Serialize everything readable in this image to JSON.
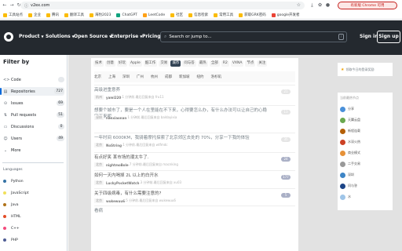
{
  "browser": {
    "url": "v2ex.com",
    "update_label": "有新版 Chrome 可用",
    "bookmarks": [
      {
        "label": "工具站点",
        "color": "#fbbc04"
      },
      {
        "label": "企业",
        "color": "#fbbc04"
      },
      {
        "label": "腾讯",
        "color": "#fbbc04"
      },
      {
        "label": "翻译工具",
        "color": "#fbbc04"
      },
      {
        "label": "海豹2023",
        "color": "#fbbc04"
      },
      {
        "label": "ChatGPT",
        "color": "#10a37f"
      },
      {
        "label": "LeetCode",
        "color": "#ffa116"
      },
      {
        "label": "社区",
        "color": "#fbbc04"
      },
      {
        "label": "信息检索",
        "color": "#fbbc04"
      },
      {
        "label": "常用工具",
        "color": "#fbbc04"
      },
      {
        "label": "获取GRK密码",
        "color": "#fbbc04"
      },
      {
        "label": "google开发者",
        "color": "#ea4335"
      }
    ]
  },
  "github": {
    "nav": [
      "Product",
      "Solutions",
      "Open Source",
      "Enterprise",
      "Pricing"
    ],
    "search_placeholder": "Search or jump to...",
    "search_key": "/",
    "signin": "Sign in",
    "signup": "Sign up"
  },
  "filter": {
    "title": "Filter by",
    "items": [
      {
        "label": "Code",
        "count": "",
        "icon": "code-icon"
      },
      {
        "label": "Repositories",
        "count": "727",
        "icon": "repo-icon"
      },
      {
        "label": "Issues",
        "count": "69",
        "icon": "issue-icon"
      },
      {
        "label": "Pull requests",
        "count": "51",
        "icon": "pull-request-icon"
      },
      {
        "label": "Discussions",
        "count": "0",
        "icon": "discussion-icon"
      },
      {
        "label": "Users",
        "count": "49",
        "icon": "user-icon"
      },
      {
        "label": "More",
        "count": "",
        "icon": "chevron-down-icon"
      }
    ],
    "languages_title": "Languages",
    "languages": [
      {
        "label": "Python",
        "color": "#3572A5"
      },
      {
        "label": "JavaScript",
        "color": "#f1e05a"
      },
      {
        "label": "Java",
        "color": "#b07219"
      },
      {
        "label": "HTML",
        "color": "#e34c26"
      },
      {
        "label": "C++",
        "color": "#f34b7d"
      },
      {
        "label": "PHP",
        "color": "#4F5D95"
      }
    ]
  },
  "v2ex": {
    "tabs": [
      "技术",
      "创意",
      "好玩",
      "Apple",
      "酷工作",
      "交易",
      "城市",
      "问与答",
      "最热",
      "全部",
      "R2",
      "VXNA",
      "节点",
      "关注"
    ],
    "active_tab": "城市",
    "subtabs": [
      "北京",
      "上海",
      "深圳",
      "广州",
      "杭州",
      "成都",
      "新加坡",
      "纽约",
      "洛杉矶"
    ],
    "topics": [
      {
        "title": "高级进重意养",
        "node": "杭州",
        "user": "yaml220",
        "time": "1 分钟前",
        "last": "最后回复来自 fru11",
        "replies": "21",
        "dark": false
      },
      {
        "title": "想要个城市了，要是一个人在里能在不下来，心得要怎么办，有什么办法可以让自己的心稳定下来呢",
        "node": "深圳",
        "user": "nanxiaonan",
        "time": "1 分钟前",
        "last": "最后回复来自 baldayixia",
        "replies": "13",
        "dark": false
      },
      {
        "title": "一年时间 6000KM，我骑着摩托探索了北京郊区去处的 70%，分享一下我的体验",
        "node": "北京",
        "user": "NoString",
        "time": "1 分钟前",
        "last": "最后回复来自 wtfmdc",
        "replies": "35",
        "dark": false
      },
      {
        "title": "有点好笑 某市场的潮太牛了.",
        "node": "北京",
        "user": "nightmoBole",
        "time": "7 分钟前",
        "last": "最后回复来自 macnking",
        "replies": "24",
        "dark": true
      },
      {
        "title": "如何一天内喝掉 2L 以上的白开水",
        "node": "北京",
        "user": "LuckyPocketWatch",
        "time": "3 分钟前",
        "last": "最后回复来自 xu03",
        "replies": "177",
        "dark": true
      },
      {
        "title": "关于四级病毒，有什么需要注意的?",
        "node": "北京",
        "user": "wukewuu6",
        "time": "5 分钟前",
        "last": "最后回复来自 wukewuu6",
        "replies": "5",
        "dark": true
      },
      {
        "title": "看病",
        "node": "",
        "user": "",
        "time": "",
        "last": "",
        "replies": "",
        "dark": false
      }
    ],
    "right_notice": "领取今日的登录奖励",
    "hot_nodes_title": "当前最热节点",
    "hot_nodes": [
      {
        "label": "分享",
        "color": "#4a90d9"
      },
      {
        "label": "天翼云盘",
        "color": "#6aa84f"
      },
      {
        "label": "新程连载",
        "color": "#b45f06"
      },
      {
        "label": "水深火热",
        "color": "#cc4125"
      },
      {
        "label": "商业模式",
        "color": "#e69138"
      },
      {
        "label": "二手交易",
        "color": "#999999"
      },
      {
        "label": "深圳",
        "color": "#3d85c6"
      },
      {
        "label": "问与答",
        "color": "#1c4587"
      },
      {
        "label": "水",
        "color": "#9fc5e8"
      }
    ]
  }
}
